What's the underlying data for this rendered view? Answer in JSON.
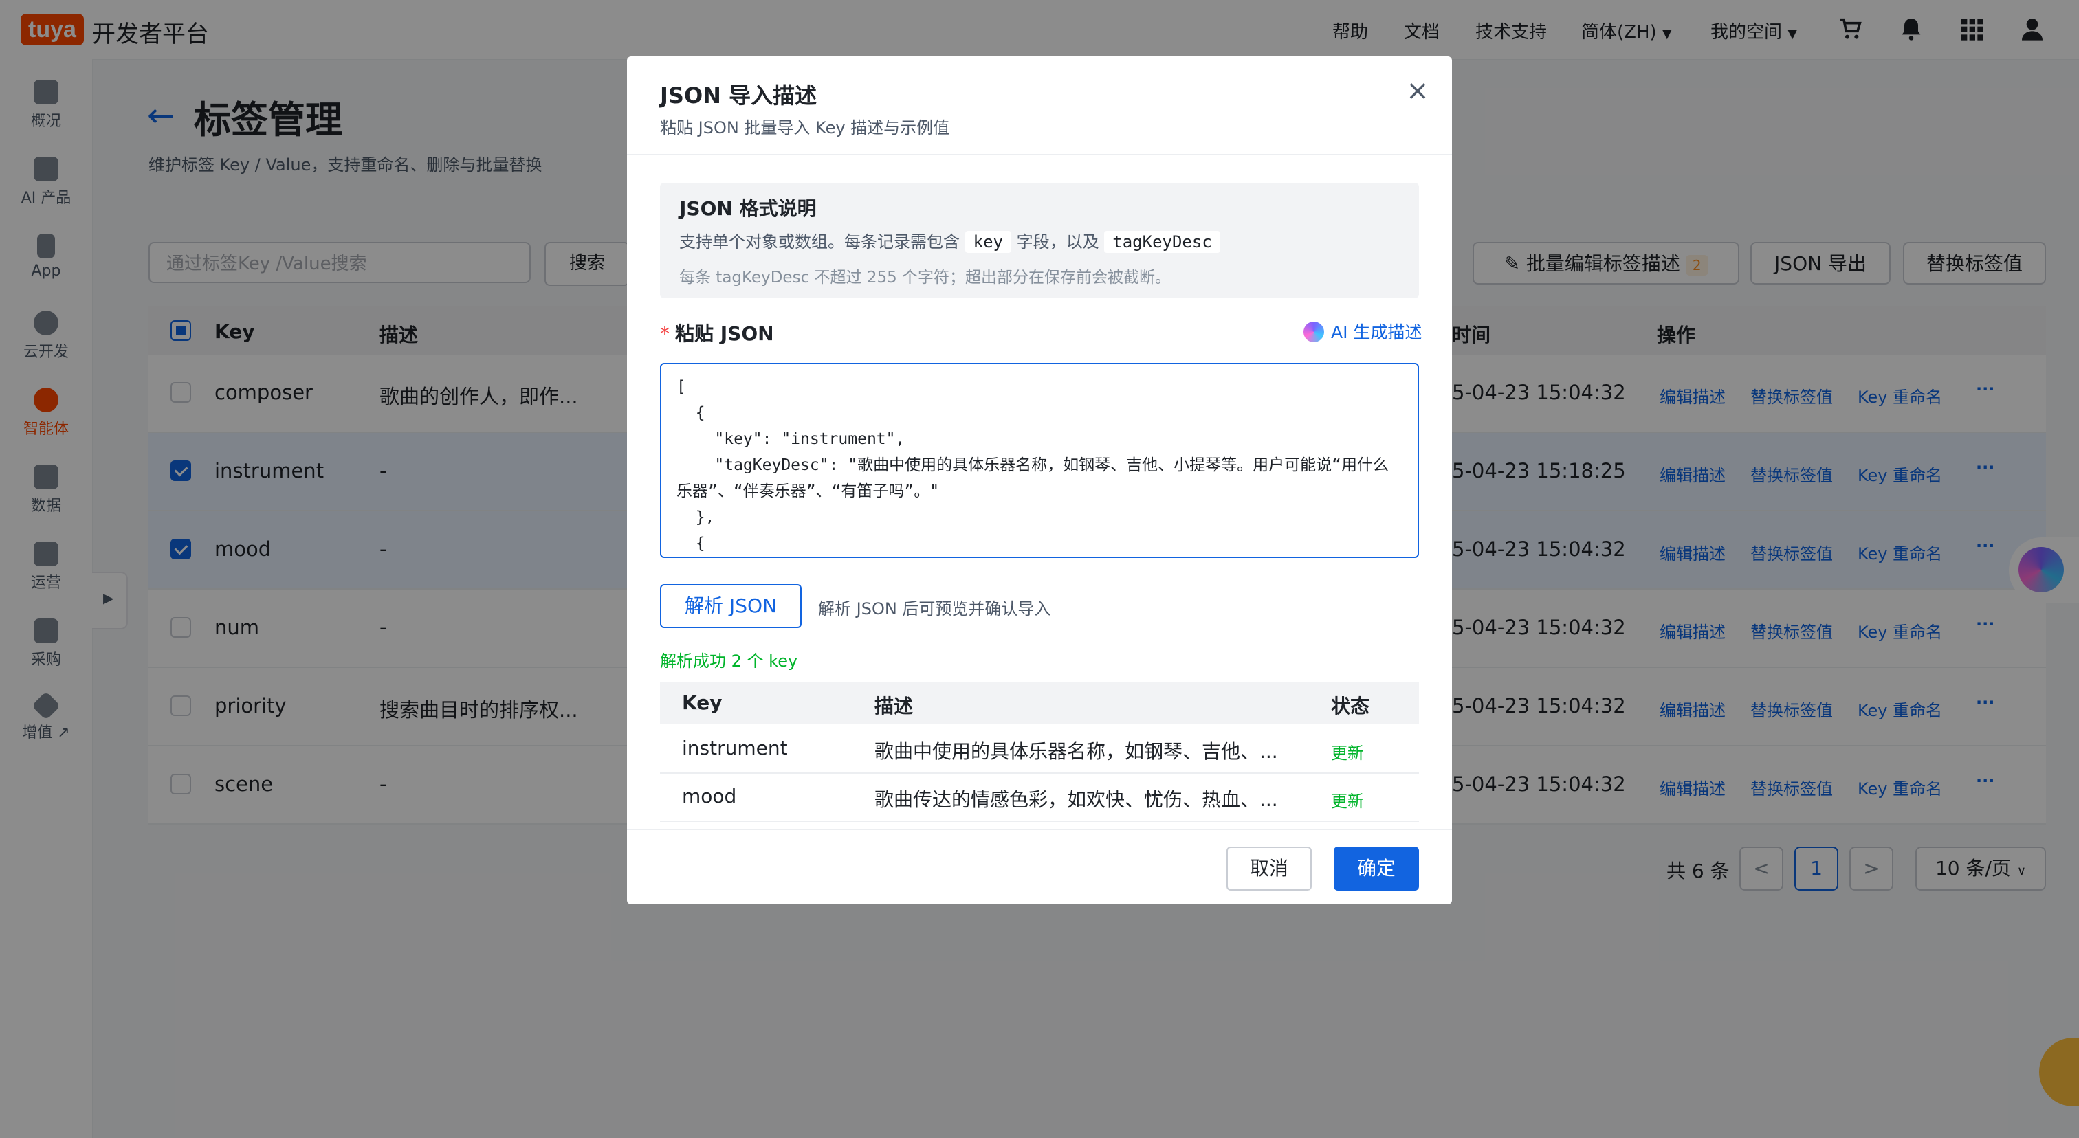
{
  "topbar": {
    "logo": "tuya",
    "platform": "开发者平台",
    "nav": [
      "帮助",
      "文档",
      "技术支持",
      "简体(ZH)",
      "我的空间"
    ],
    "icons": [
      "cart-icon",
      "bell-icon",
      "apps-grid-icon",
      "user-icon"
    ]
  },
  "sidebar": {
    "items": [
      {
        "label": "概况",
        "icon": "home-icon"
      },
      {
        "label": "AI 产品",
        "icon": "terminal-icon"
      },
      {
        "label": "App",
        "icon": "phone-icon"
      },
      {
        "label": "云开发",
        "icon": "cloud-icon"
      },
      {
        "label": "智能体",
        "icon": "agent-icon"
      },
      {
        "label": "数据",
        "icon": "chart-icon"
      },
      {
        "label": "运营",
        "icon": "star-icon"
      },
      {
        "label": "采购",
        "icon": "cart-icon"
      },
      {
        "label": "增值 ↗",
        "icon": "diamond-icon"
      }
    ]
  },
  "page": {
    "title": "标签管理",
    "subtitle": "维护标签 Key / Value，支持重命名、删除与批量替换",
    "search_placeholder": "通过标签Key /Value搜索",
    "search_button": "搜索",
    "batch_edit": "批量编辑标签描述",
    "batch_count": "2",
    "export": "JSON 导出",
    "replace": "替换标签值"
  },
  "table": {
    "headers": {
      "key": "Key",
      "desc": "描述",
      "time": "时间",
      "ops": "操作"
    },
    "rows": [
      {
        "key": "composer",
        "desc": "歌曲的创作人，即作...",
        "time": "5-04-23 15:04:32",
        "checked": false
      },
      {
        "key": "instrument",
        "desc": "-",
        "time": "5-04-23 15:18:25",
        "checked": true
      },
      {
        "key": "mood",
        "desc": "-",
        "time": "5-04-23 15:04:32",
        "checked": true
      },
      {
        "key": "num",
        "desc": "-",
        "time": "5-04-23 15:04:32",
        "checked": false
      },
      {
        "key": "priority",
        "desc": "搜索曲目时的排序权...",
        "time": "5-04-23 15:04:32",
        "checked": false
      },
      {
        "key": "scene",
        "desc": "-",
        "time": "5-04-23 15:04:32",
        "checked": false
      }
    ],
    "actions": {
      "edit": "编辑描述",
      "replace": "替换标签值",
      "rename": "Key 重命名",
      "more": "···"
    }
  },
  "pager": {
    "total": "共 6 条",
    "prev": "<",
    "current": "1",
    "next": ">",
    "size": "10 条/页"
  },
  "modal": {
    "title": "JSON 导入描述",
    "subtitle": "粘贴 JSON 批量导入 Key 描述与示例值",
    "close": "×",
    "info_title": "JSON 格式说明",
    "info_line_a": "支持单个对象或数组。每条记录需包含",
    "info_code_key": "key",
    "info_line_b": "字段，以及",
    "info_code_desc": "tagKeyDesc",
    "info_note": "每条 tagKeyDesc 不超过 255 个字符；超出部分在保存前会被截断。",
    "paste_label": "粘贴 JSON",
    "ai_generate": "AI 生成描述",
    "json_text": "[\n  {\n    \"key\": \"instrument\",\n    \"tagKeyDesc\": \"歌曲中使用的具体乐器名称，如钢琴、吉他、小提琴等。用户可能说“用什么乐器”、“伴奏乐器”、“有笛子吗”。\"\n  },\n  {",
    "parse_button": "解析 JSON",
    "parse_hint": "解析 JSON 后可预览并确认导入",
    "parse_success": "解析成功 2 个 key",
    "preview_headers": {
      "key": "Key",
      "desc": "描述",
      "status": "状态"
    },
    "preview_rows": [
      {
        "key": "instrument",
        "desc": "歌曲中使用的具体乐器名称，如钢琴、吉他、...",
        "status": "更新"
      },
      {
        "key": "mood",
        "desc": "歌曲传达的情感色彩，如欢快、忧伤、热血、...",
        "status": "更新"
      }
    ],
    "cancel": "取消",
    "confirm": "确定"
  }
}
